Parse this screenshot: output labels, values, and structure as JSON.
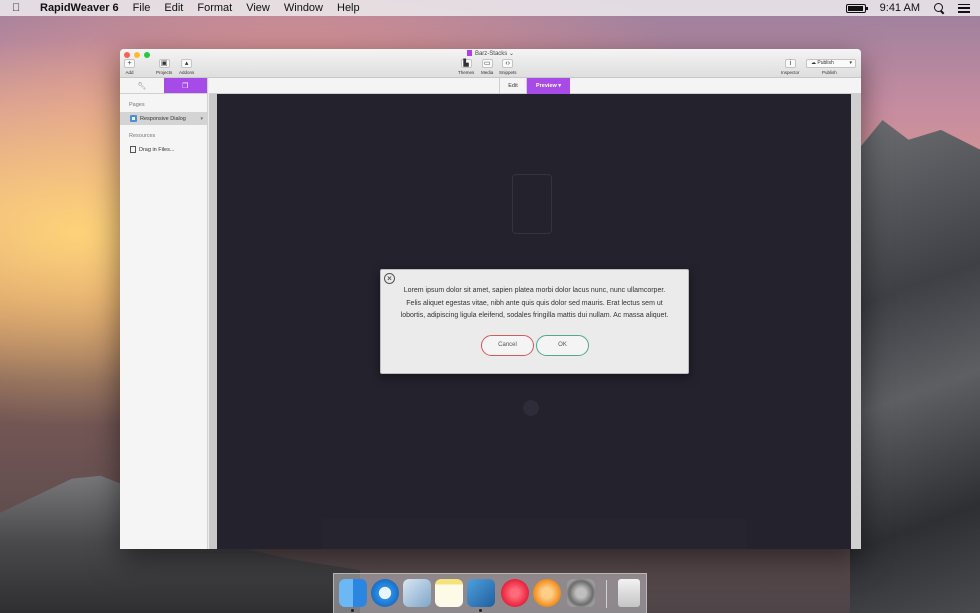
{
  "menubar": {
    "app_name": "RapidWeaver 6",
    "items": [
      "File",
      "Edit",
      "Format",
      "View",
      "Window",
      "Help"
    ],
    "clock": "9:41 AM"
  },
  "window": {
    "document_title": "Barz-Stacks",
    "toolbar": {
      "add": "Add",
      "projects": "Projects",
      "addons": "Addons",
      "themes": "Themes",
      "media": "Media",
      "snippets": "Snippets",
      "inspector": "Inspector",
      "publish_button": "Publish",
      "publish_label": "Publish"
    },
    "sidebar": {
      "pages_heading": "Pages",
      "pages": [
        {
          "label": "Responsive Dialog"
        }
      ],
      "resources_heading": "Resources",
      "resources": [
        {
          "label": "Drag in Files..."
        }
      ]
    },
    "modebar": {
      "edit": "Edit",
      "preview": "Preview"
    }
  },
  "dialog": {
    "close_symbol": "×",
    "text": "Lorem ipsum dolor sit amet, sapien platea morbi dolor lacus nunc, nunc ullamcorper. Felis aliquet egestas vitae, nibh ante quis quis dolor sed mauris. Erat lectus sem ut lobortis, adipiscing ligula eleifend, sodales fringilla mattis dui nullam. Ac massa aliquet.",
    "cancel_label": "Cancel",
    "ok_label": "OK"
  },
  "dock": {
    "apps": [
      "finder-icon",
      "safari-icon",
      "mail-icon",
      "notes-icon",
      "xcode-icon",
      "itunes-icon",
      "ibooks-icon",
      "system-preferences-icon",
      "trash-icon"
    ]
  },
  "colors": {
    "accent": "#a64ae8",
    "cancel_border": "#d15c5c",
    "ok_border": "#4fa98a",
    "preview_bg": "#23222d"
  }
}
